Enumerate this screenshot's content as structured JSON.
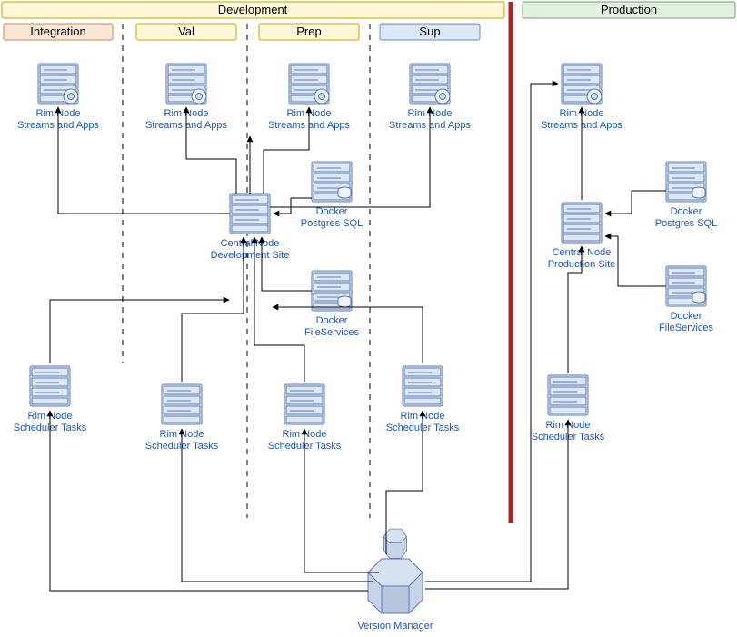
{
  "panels": {
    "dev": {
      "title": "Development",
      "fill": "#FFF7D6",
      "stroke": "#C9A400"
    },
    "prod": {
      "title": "Production",
      "fill": "#E3F2DF",
      "stroke": "#6FA36B"
    },
    "integration": {
      "title": "Integration",
      "fill": "#FBE6D6",
      "stroke": "#C98A54"
    },
    "val": {
      "title": "Val",
      "fill": "#FFF7D6",
      "stroke": "#C9A400"
    },
    "prep": {
      "title": "Prep",
      "fill": "#FFF7D6",
      "stroke": "#C9A400"
    },
    "sup": {
      "title": "Sup",
      "fill": "#DCE8F7",
      "stroke": "#6B8FC2"
    }
  },
  "labels": {
    "rim_streams": {
      "l1": "Rim Node",
      "l2": "Streams and Apps"
    },
    "rim_sched": {
      "l1": "Rim Node",
      "l2": "Scheduler Tasks"
    },
    "central_dev": {
      "l1": "Central Node",
      "l2": "Development Site"
    },
    "central_prod": {
      "l1": "Central Node",
      "l2": "Production Site"
    },
    "docker_pg": {
      "l1": "Docker",
      "l2": "Postgres SQL"
    },
    "docker_fs": {
      "l1": "Docker",
      "l2": "FileServices"
    },
    "version_mgr": "Version Manager"
  },
  "chart_data": {
    "type": "architecture-diagram",
    "environments": [
      {
        "name": "Development",
        "lanes": [
          "Integration",
          "Val",
          "Prep",
          "Sup"
        ]
      },
      {
        "name": "Production"
      }
    ],
    "nodes": [
      {
        "id": "rim_streams_int",
        "type": "Rim Node Streams and Apps",
        "env": "Development",
        "lane": "Integration"
      },
      {
        "id": "rim_streams_val",
        "type": "Rim Node Streams and Apps",
        "env": "Development",
        "lane": "Val"
      },
      {
        "id": "rim_streams_prep",
        "type": "Rim Node Streams and Apps",
        "env": "Development",
        "lane": "Prep"
      },
      {
        "id": "rim_streams_sup",
        "type": "Rim Node Streams and Apps",
        "env": "Development",
        "lane": "Sup"
      },
      {
        "id": "rim_streams_prod",
        "type": "Rim Node Streams and Apps",
        "env": "Production"
      },
      {
        "id": "central_dev",
        "type": "Central Node Development Site",
        "env": "Development"
      },
      {
        "id": "central_prod",
        "type": "Central Node Production Site",
        "env": "Production"
      },
      {
        "id": "docker_pg_dev",
        "type": "Docker Postgres SQL",
        "env": "Development"
      },
      {
        "id": "docker_fs_dev",
        "type": "Docker FileServices",
        "env": "Development"
      },
      {
        "id": "docker_pg_prod",
        "type": "Docker Postgres SQL",
        "env": "Production"
      },
      {
        "id": "docker_fs_prod",
        "type": "Docker FileServices",
        "env": "Production"
      },
      {
        "id": "rim_sched_1",
        "type": "Rim Node Scheduler Tasks",
        "env": "Development"
      },
      {
        "id": "rim_sched_2",
        "type": "Rim Node Scheduler Tasks",
        "env": "Development"
      },
      {
        "id": "rim_sched_3",
        "type": "Rim Node Scheduler Tasks",
        "env": "Development"
      },
      {
        "id": "rim_sched_4",
        "type": "Rim Node Scheduler Tasks",
        "env": "Development"
      },
      {
        "id": "rim_sched_prod",
        "type": "Rim Node Scheduler Tasks",
        "env": "Production"
      },
      {
        "id": "version_mgr",
        "type": "Version Manager"
      }
    ],
    "edges": [
      {
        "from": "central_dev",
        "to": "rim_streams_int"
      },
      {
        "from": "central_dev",
        "to": "rim_streams_val"
      },
      {
        "from": "central_dev",
        "to": "rim_streams_prep"
      },
      {
        "from": "central_dev",
        "to": "rim_streams_sup"
      },
      {
        "from": "docker_pg_dev",
        "to": "central_dev"
      },
      {
        "from": "docker_fs_dev",
        "to": "central_dev"
      },
      {
        "from": "rim_sched_1",
        "to": "central_dev"
      },
      {
        "from": "rim_sched_2",
        "to": "central_dev"
      },
      {
        "from": "rim_sched_3",
        "to": "central_dev"
      },
      {
        "from": "rim_sched_4",
        "to": "central_dev"
      },
      {
        "from": "version_mgr",
        "to": "rim_sched_1"
      },
      {
        "from": "version_mgr",
        "to": "rim_sched_2"
      },
      {
        "from": "version_mgr",
        "to": "rim_sched_3"
      },
      {
        "from": "version_mgr",
        "to": "rim_sched_4"
      },
      {
        "from": "version_mgr",
        "to": "rim_sched_prod"
      },
      {
        "from": "version_mgr",
        "to": "rim_streams_prod"
      },
      {
        "from": "rim_sched_prod",
        "to": "central_prod"
      },
      {
        "from": "central_prod",
        "to": "rim_streams_prod"
      },
      {
        "from": "docker_pg_prod",
        "to": "central_prod"
      },
      {
        "from": "docker_fs_prod",
        "to": "central_prod"
      }
    ]
  }
}
